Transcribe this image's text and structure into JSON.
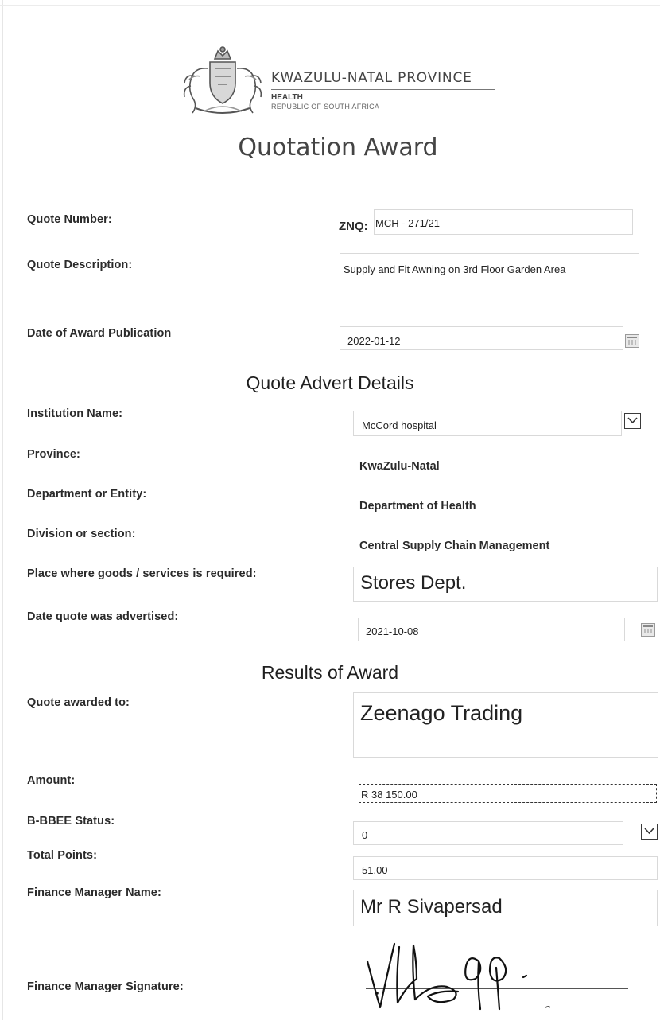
{
  "header": {
    "province": "KWAZULU-NATAL PROVINCE",
    "department": "HEALTH",
    "country": "REPUBLIC OF SOUTH AFRICA"
  },
  "title": "Quotation Award",
  "quote": {
    "number_label": "Quote Number:",
    "number_prefix": "ZNQ:",
    "number_value": "MCH - 271/21",
    "description_label": "Quote Description:",
    "description_value": "Supply and Fit Awning on 3rd Floor Garden Area",
    "award_date_label": "Date of Award Publication",
    "award_date_value": "2022-01-12"
  },
  "advert": {
    "heading": "Quote Advert Details",
    "institution_label": "Institution Name:",
    "institution_value": "McCord hospital",
    "province_label": "Province:",
    "province_value": "KwaZulu-Natal",
    "department_label": "Department or Entity:",
    "department_value": "Department of Health",
    "division_label": "Division or section:",
    "division_value": "Central Supply Chain Management",
    "place_label": "Place where goods /  services is required:",
    "place_value": "Stores Dept.",
    "advertised_label": "Date quote was advertised:",
    "advertised_value": "2021-10-08"
  },
  "results": {
    "heading": "Results of Award",
    "awarded_label": "Quote awarded to:",
    "awarded_value": "Zeenago Trading",
    "amount_label": "Amount:",
    "amount_value": "R 38 150.00",
    "bbbee_label": "B-BBEE Status:",
    "bbbee_value": "0",
    "points_label": "Total Points:",
    "points_value": "51.00",
    "fm_name_label": "Finance Manager Name:",
    "fm_name_value": "Mr R Sivapersad",
    "fm_signature_label": "Finance Manager Signature:"
  }
}
